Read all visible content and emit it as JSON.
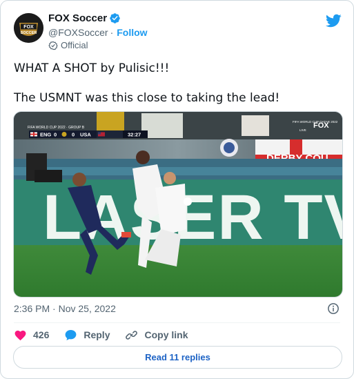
{
  "author": {
    "display_name": "FOX Soccer",
    "handle": "@FOXSoccer",
    "separator": "·",
    "follow_label": "Follow",
    "affiliation": "Official",
    "avatar_text_top": "FOX",
    "avatar_text_bottom": "SOCCER"
  },
  "tweet": {
    "lines": [
      "WHAT A SHOT by Pulisic!!!",
      "The USMNT was this close to taking the lead!"
    ]
  },
  "media": {
    "broadcast_tag": "FIFA WORLD CUP QATAR 2022",
    "network": "FOX",
    "live_label": "LIVE",
    "scorebug": {
      "event": "FIFA WORLD CUP 2022 · GROUP B",
      "team1": "ENG",
      "score1": "0",
      "score2": "0",
      "team2": "USA",
      "clock": "32:27"
    },
    "billboard": "LASER TV.",
    "stand_banner": "DERBY COU"
  },
  "meta": {
    "time": "2:36 PM",
    "date_separator": "·",
    "date": "Nov 25, 2022"
  },
  "actions": {
    "like_count": "426",
    "reply_label": "Reply",
    "copy_link_label": "Copy link",
    "read_replies_label": "Read 11 replies"
  },
  "colors": {
    "accent_blue": "#1d9bf0",
    "like_red": "#f91880",
    "link_blue": "#1d63c5",
    "muted_text": "#536471"
  },
  "icons": [
    "verified-badge-icon",
    "twitter-bird-icon",
    "official-badge-icon",
    "info-icon",
    "heart-icon",
    "reply-bubble-icon",
    "link-icon"
  ]
}
